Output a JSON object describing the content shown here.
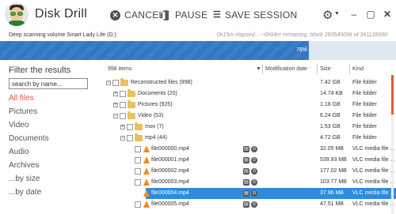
{
  "app": {
    "title": "Disk Drill"
  },
  "toolbar": {
    "cancel_label": "CANCEL",
    "pause_label": "PAUSE",
    "save_label": "SAVE SESSION"
  },
  "status": {
    "left_text": "Deep scanning volume Smart Lady Life (D:)",
    "right_text": "0h15m elapsed... ~0h04m remaining, block 283540096 of 361128600"
  },
  "progress": {
    "value": 78,
    "label": "78%"
  },
  "colors": {
    "accent": "#e5573b",
    "progress": "#3d7fc7",
    "selection": "#2d8be0"
  },
  "sidebar": {
    "filter_title": "Filter the results",
    "search_placeholder": "search by name...",
    "items": [
      {
        "label": "All files",
        "active": true
      },
      {
        "label": "Pictures"
      },
      {
        "label": "Video"
      },
      {
        "label": "Documents"
      },
      {
        "label": "Audio"
      },
      {
        "label": "Archives"
      },
      {
        "label": "...by size"
      },
      {
        "label": "...by date"
      }
    ]
  },
  "list": {
    "items_count": "998 items",
    "columns": {
      "modification_date": "Modification date",
      "size": "Size",
      "kind": "Kind"
    },
    "rows": [
      {
        "name": "Reconstructed files (998)",
        "size": "7.42 GB",
        "kind": "File folder",
        "icon": "folder-icon",
        "expander": "-"
      },
      {
        "name": "Documents (20)",
        "size": "14.74 KB",
        "kind": "File folder",
        "icon": "folder-icon",
        "expander": "+"
      },
      {
        "name": "Pictures (925)",
        "size": "1.18 GB",
        "kind": "File folder",
        "icon": "folder-icon",
        "expander": "+"
      },
      {
        "name": "Video (53)",
        "size": "6.24 GB",
        "kind": "File folder",
        "icon": "folder-icon",
        "expander": "-"
      },
      {
        "name": "mov (7)",
        "size": "1.53 GB",
        "kind": "File folder",
        "icon": "folder-icon",
        "expander": "+"
      },
      {
        "name": "mp4 (44)",
        "size": "4.72 GB",
        "kind": "File folder",
        "icon": "folder-icon",
        "expander": "-"
      },
      {
        "name": "file000000.mp4",
        "size": "32.05 MB",
        "kind": "VLC media file ...",
        "icon": "vlc-icon"
      },
      {
        "name": "file000001.mp4",
        "size": "539.93 MB",
        "kind": "VLC media file ...",
        "icon": "vlc-icon"
      },
      {
        "name": "file000002.mp4",
        "size": "177.02 MB",
        "kind": "VLC media file ...",
        "icon": "vlc-icon"
      },
      {
        "name": "file000003.mp4",
        "size": "103.77 MB",
        "kind": "VLC media file ...",
        "icon": "vlc-icon"
      },
      {
        "name": "file000004.mp4",
        "size": "37.96 MB",
        "kind": "VLC media file ...",
        "icon": "vlc-icon",
        "selected": true
      },
      {
        "name": "file000005.mp4",
        "size": "47.51 MB",
        "kind": "VLC media file ...",
        "icon": "vlc-icon"
      }
    ]
  }
}
